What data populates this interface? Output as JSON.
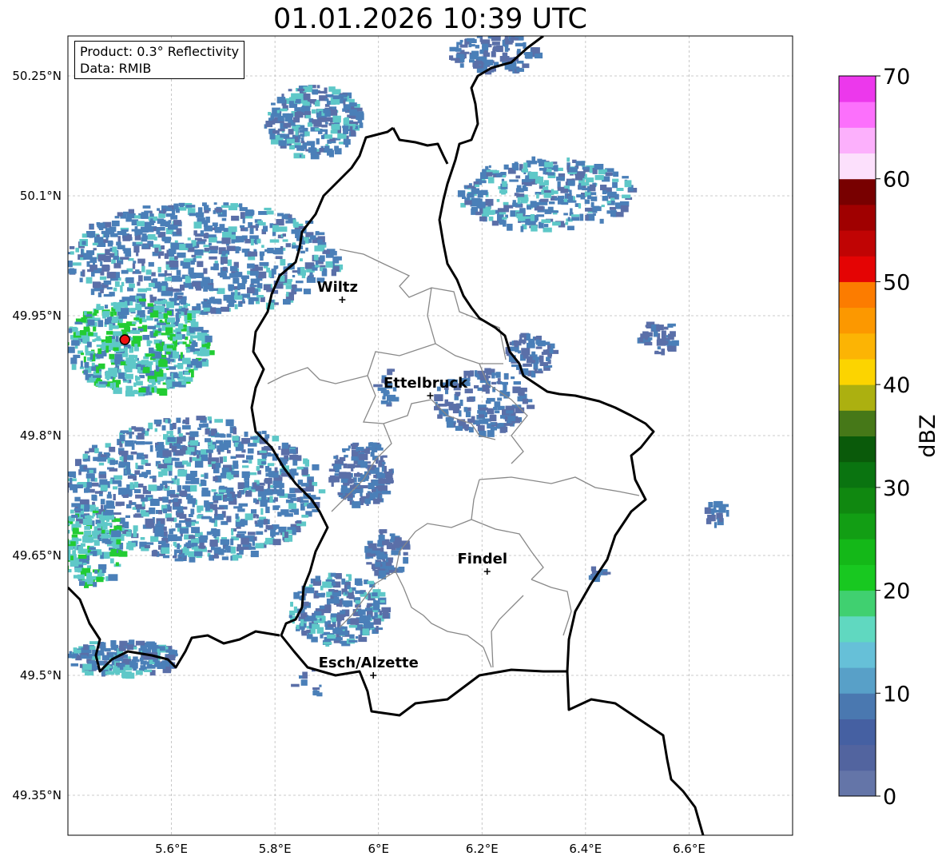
{
  "title": "01.01.2026 10:39 UTC",
  "info": {
    "product": "Product: 0.3° Reflectivity",
    "data": "Data: RMIB"
  },
  "axes": {
    "lon_ticks": [
      {
        "value": 5.6,
        "label": "5.6°E"
      },
      {
        "value": 5.8,
        "label": "5.8°E"
      },
      {
        "value": 6.0,
        "label": "6°E"
      },
      {
        "value": 6.2,
        "label": "6.2°E"
      },
      {
        "value": 6.4,
        "label": "6.4°E"
      },
      {
        "value": 6.6,
        "label": "6.6°E"
      }
    ],
    "lat_ticks": [
      {
        "value": 50.25,
        "label": "50.25°N"
      },
      {
        "value": 50.1,
        "label": "50.1°N"
      },
      {
        "value": 49.95,
        "label": "49.95°N"
      },
      {
        "value": 49.8,
        "label": "49.8°N"
      },
      {
        "value": 49.65,
        "label": "49.65°N"
      },
      {
        "value": 49.5,
        "label": "49.5°N"
      },
      {
        "value": 49.35,
        "label": "49.35°N"
      }
    ],
    "lon_range": [
      5.4,
      6.8
    ],
    "lat_range": [
      49.3,
      50.3
    ]
  },
  "cities": [
    {
      "name": "Wiltz",
      "lon": 5.93,
      "lat": 49.97
    },
    {
      "name": "Ettelbruck",
      "lon": 6.1,
      "lat": 49.85
    },
    {
      "name": "Findel",
      "lon": 6.21,
      "lat": 49.63
    },
    {
      "name": "Esch/Alzette",
      "lon": 5.99,
      "lat": 49.5
    }
  ],
  "radar_site": {
    "lon": 5.51,
    "lat": 49.92,
    "color": "#ee1111"
  },
  "colorbar": {
    "label": "dBZ",
    "min": 0,
    "max": 70,
    "ticks": [
      {
        "value": 0,
        "label": "0"
      },
      {
        "value": 10,
        "label": "10"
      },
      {
        "value": 20,
        "label": "20"
      },
      {
        "value": 30,
        "label": "30"
      },
      {
        "value": 40,
        "label": "40"
      },
      {
        "value": 50,
        "label": "50"
      },
      {
        "value": 60,
        "label": "60"
      },
      {
        "value": 70,
        "label": "70"
      }
    ],
    "colors": [
      "#6475a8",
      "#52649f",
      "#4560a2",
      "#4a78b0",
      "#58a0c8",
      "#66c0d8",
      "#60d8c0",
      "#40d070",
      "#18c820",
      "#14b818",
      "#129e14",
      "#108810",
      "#0a7410",
      "#0a5a0a",
      "#467818",
      "#acb010",
      "#fcd400",
      "#fcb404",
      "#fc9800",
      "#fc7c00",
      "#e40404",
      "#c00404",
      "#a00000",
      "#780000",
      "#fce0fc",
      "#fcb0fc",
      "#fc70fc",
      "#ec38ec"
    ]
  },
  "colors": {
    "border": "#000000",
    "canton": "#888888",
    "grid": "#bbbbbb",
    "echo_light": "#5a6fa8",
    "echo_mid": "#4a7fb8",
    "echo_cyan": "#5ec8c8",
    "echo_green": "#22cc33"
  }
}
